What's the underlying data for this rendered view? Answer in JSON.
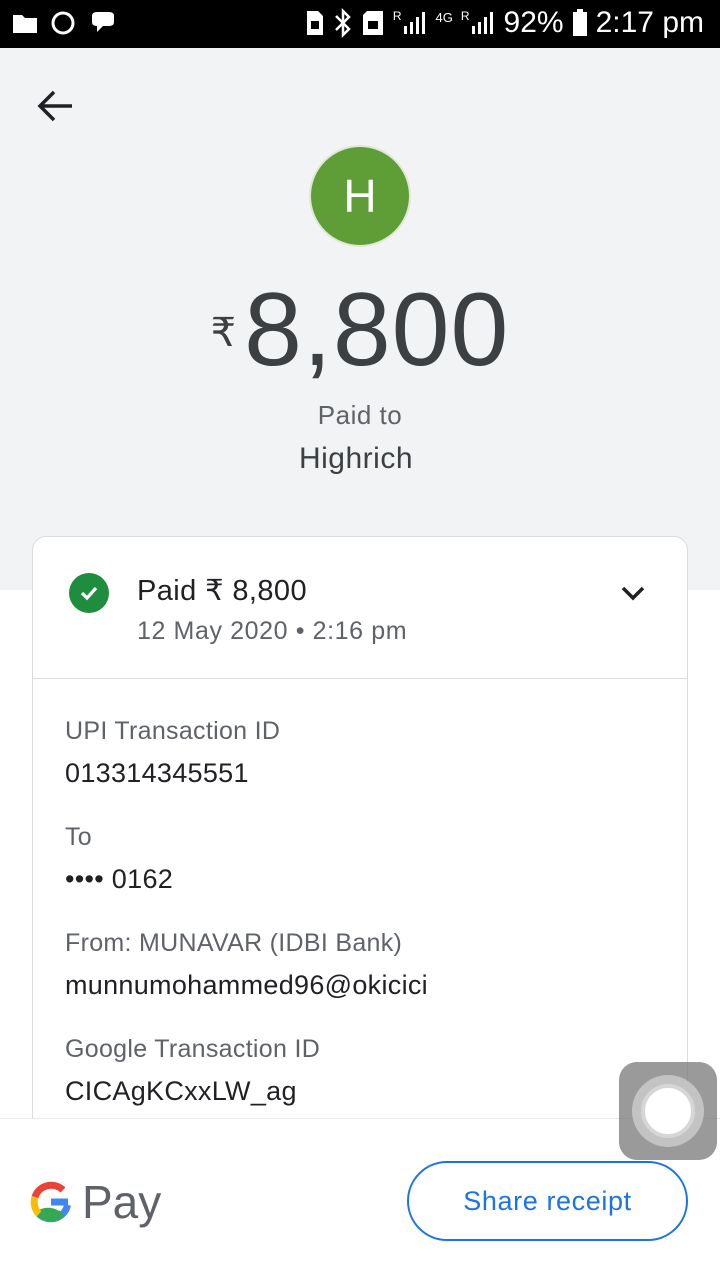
{
  "status_bar": {
    "network_4g": "4G",
    "roaming_1": "R",
    "roaming_2": "R",
    "battery_percent": "92%",
    "time": "2:17 pm",
    "icons": [
      "folder-icon",
      "circle-icon",
      "chat-icon",
      "sim-icon",
      "bluetooth-icon",
      "sd-card-icon",
      "signal-icon",
      "battery-icon"
    ]
  },
  "header": {
    "avatar_initial": "H",
    "avatar_color": "#5f9e37",
    "currency_symbol": "₹",
    "amount": "8,800",
    "paid_to_label": "Paid to",
    "payee_name": "Highrich"
  },
  "summary": {
    "title": "Paid ₹ 8,800",
    "date": "12 May 2020 • 2:16 pm",
    "status_color": "#1e8e3e"
  },
  "details": [
    {
      "label": "UPI Transaction ID",
      "value": "013314345551"
    },
    {
      "label": "To",
      "value": "•••• 0162"
    },
    {
      "label": "From: MUNAVAR (IDBI Bank)",
      "value": "munnumohammed96@okicici"
    },
    {
      "label": "Google Transaction ID",
      "value": "CICAgKCxxLW_ag"
    }
  ],
  "footer": {
    "brand_word": "Pay",
    "share_button": "Share receipt",
    "accent_color": "#1a73e8"
  }
}
